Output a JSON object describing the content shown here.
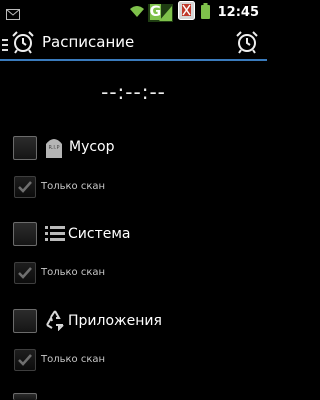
{
  "status_bar": {
    "time": "12:45",
    "network_badge": "G"
  },
  "action_bar": {
    "title": "Расписание"
  },
  "timer": {
    "value": "--:--:--"
  },
  "rows": [
    {
      "label": "Мусор",
      "icon": "trash-rip-icon",
      "sub_label": "Только скан",
      "enabled": false,
      "scan_only": true
    },
    {
      "label": "Система",
      "icon": "list-icon",
      "sub_label": "Только скан",
      "enabled": false,
      "scan_only": true
    },
    {
      "label": "Приложения",
      "icon": "recycle-icon",
      "sub_label": "Только скан",
      "enabled": false,
      "scan_only": true
    }
  ],
  "colors": {
    "accent": "#3a7bbd",
    "background": "#000000",
    "check": "#6f6f6f"
  }
}
